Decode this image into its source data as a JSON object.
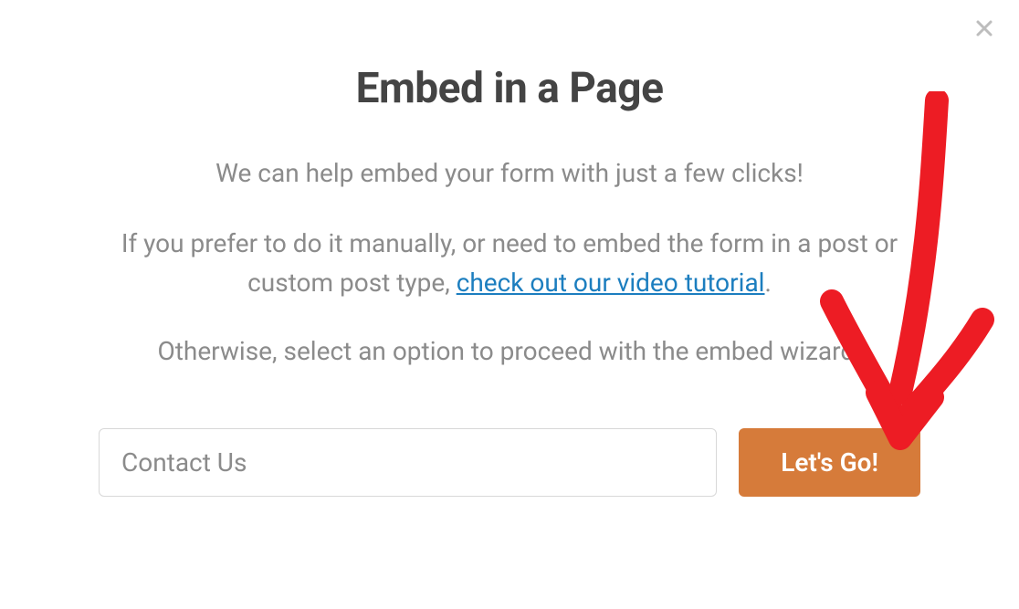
{
  "modal": {
    "title": "Embed in a Page",
    "subtitle": "We can help embed your form with just a few clicks!",
    "manual_prefix": "If you prefer to do it manually, or need to embed the form in a post or custom post type, ",
    "link_text": "check out our video tutorial",
    "manual_suffix": ".",
    "otherwise": "Otherwise, select an option to proceed with the embed wizard.",
    "input_value": "Contact Us",
    "button_label": "Let's Go!"
  }
}
